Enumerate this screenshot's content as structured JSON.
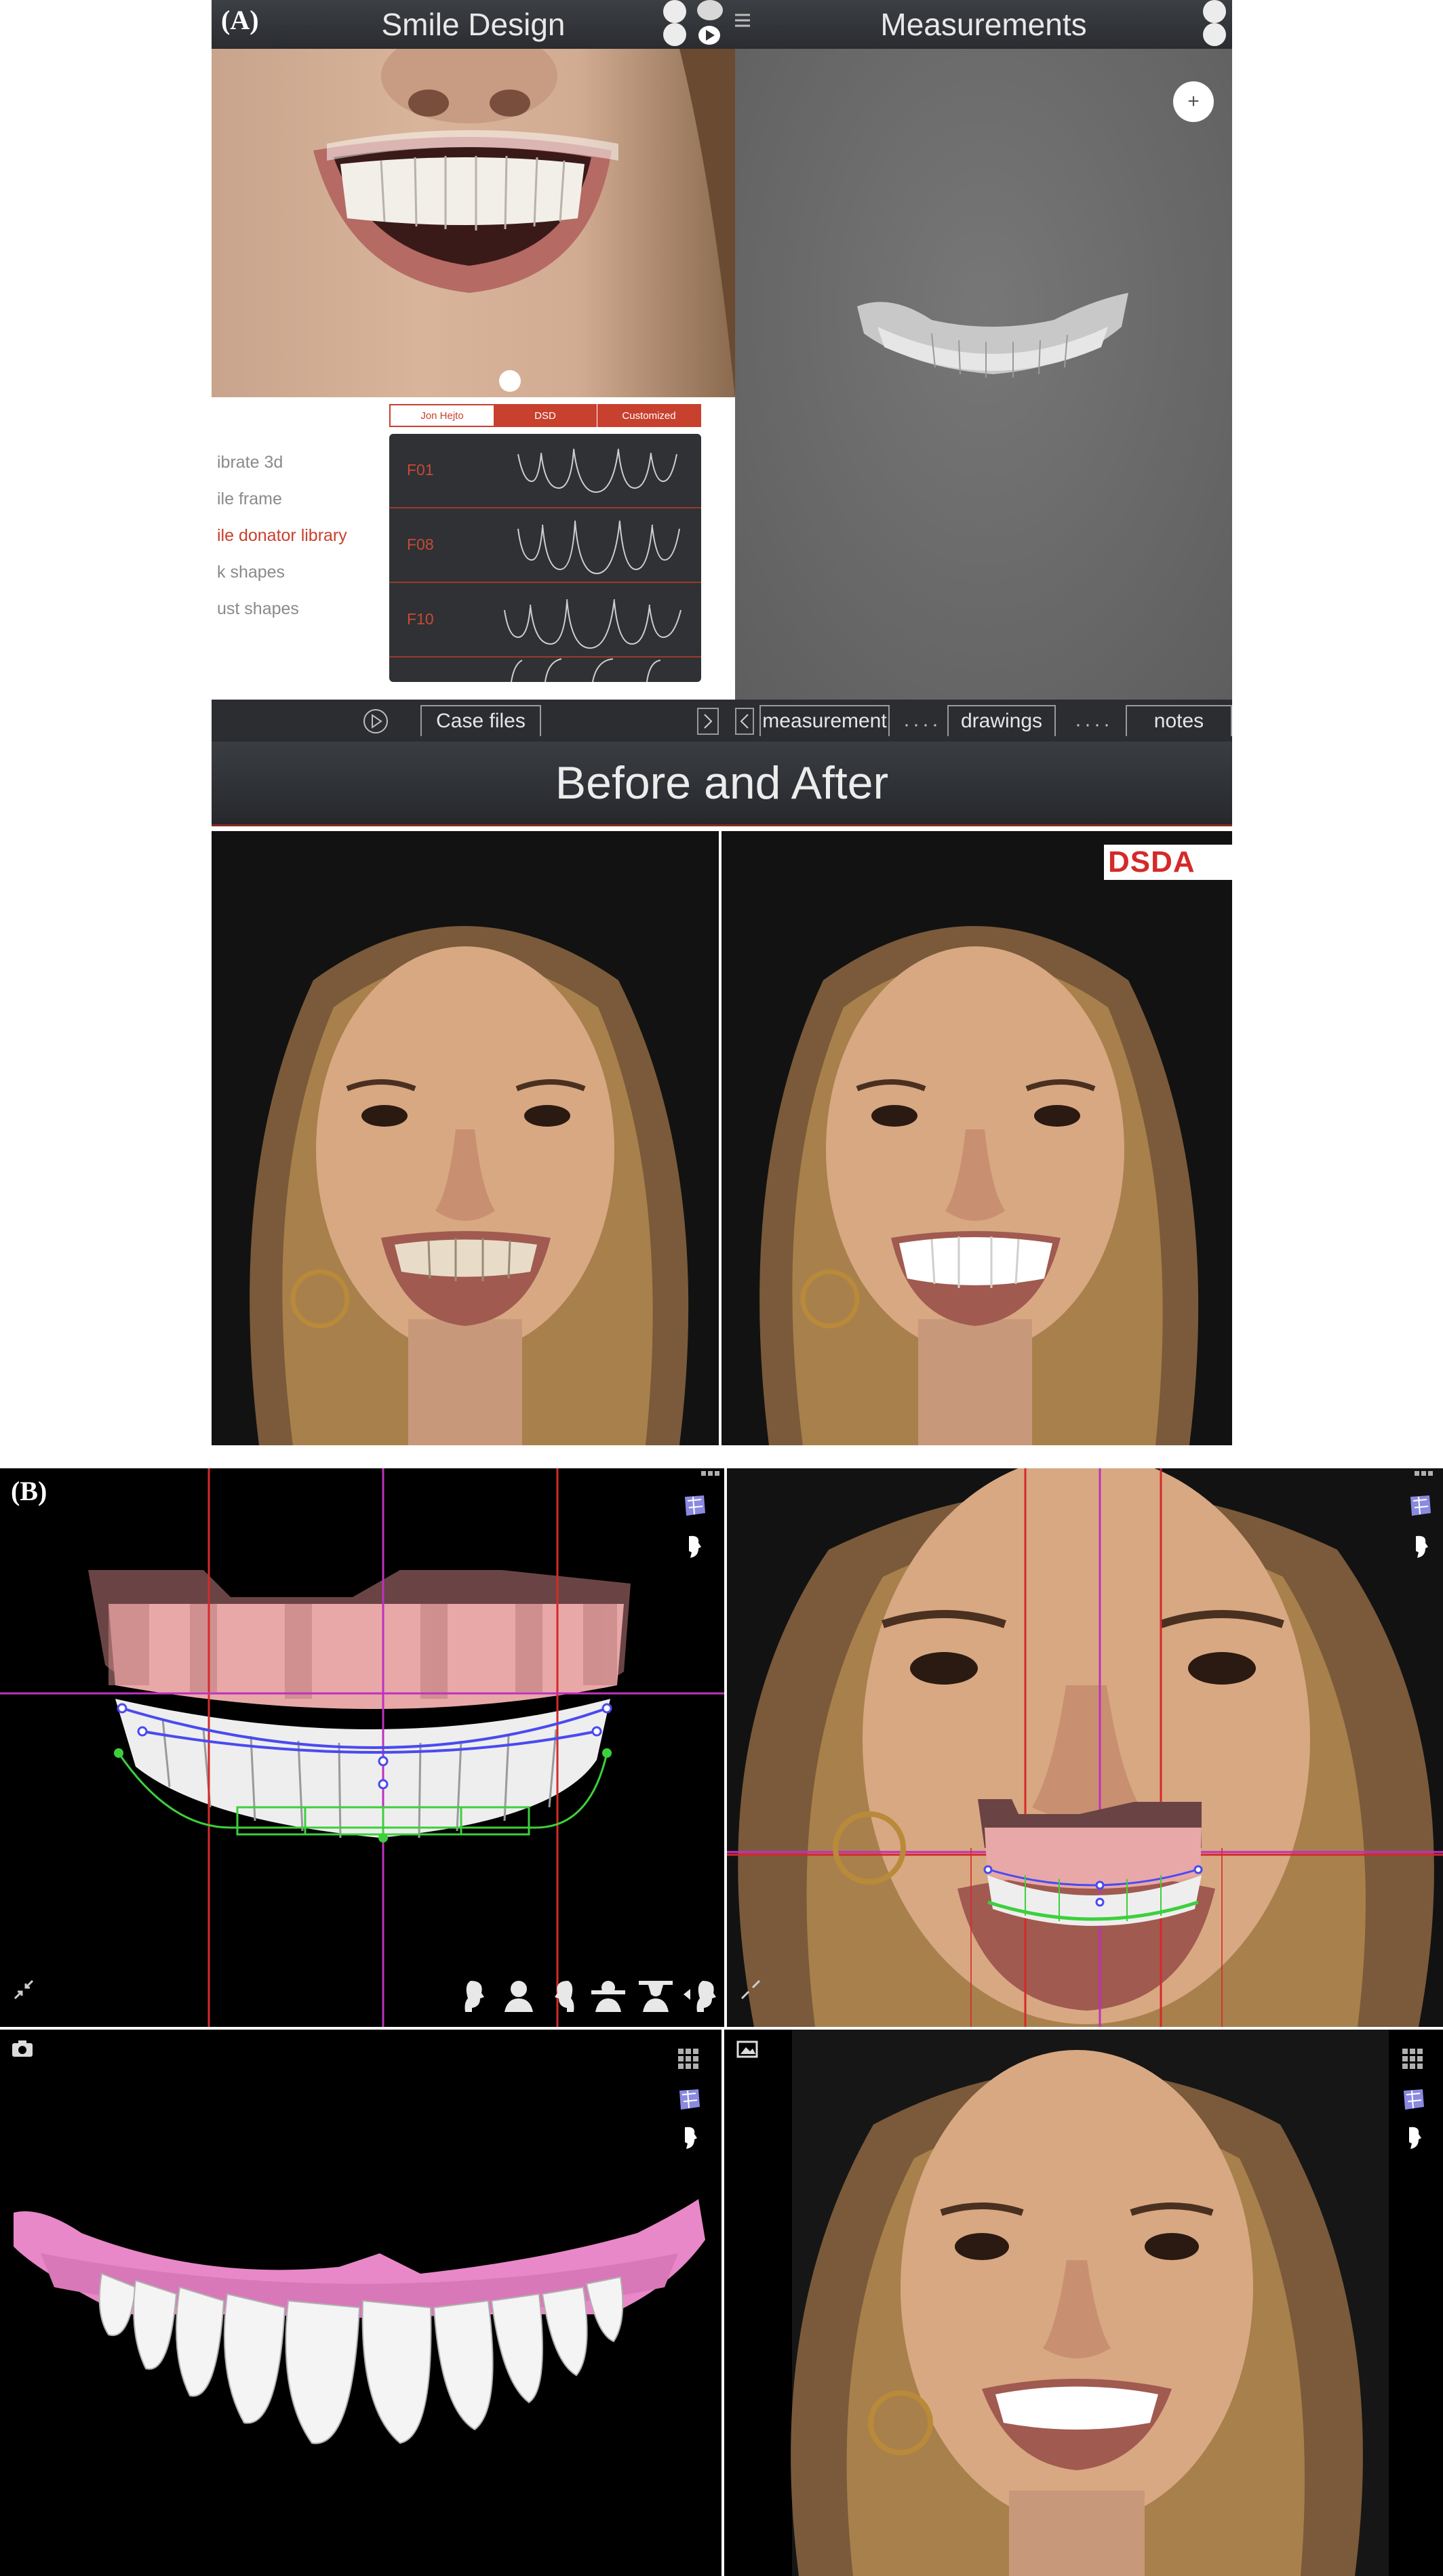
{
  "panel_a": {
    "label": "(A)",
    "smile_design": {
      "title": "Smile Design",
      "menu": [
        {
          "label": "ibrate 3d",
          "active": false
        },
        {
          "label": "ile frame",
          "active": false
        },
        {
          "label": "ile donator library",
          "active": true
        },
        {
          "label": "k shapes",
          "active": false
        },
        {
          "label": "ust shapes",
          "active": false
        }
      ],
      "library_tabs": [
        {
          "label": "Jon Hejto",
          "active": false
        },
        {
          "label": "DSD",
          "active": true
        },
        {
          "label": "Customized",
          "active": false
        }
      ],
      "library_items": [
        "F01",
        "F08",
        "F10"
      ]
    },
    "measurements": {
      "title": "Measurements",
      "add_button": "+"
    },
    "bottom_bar": {
      "case_files": "Case files",
      "tabs": [
        "measurement",
        "drawings",
        "notes"
      ],
      "dots": "····"
    },
    "before_after": {
      "title": "Before and After",
      "logo": "DSDA"
    }
  },
  "panel_b": {
    "label": "(B)"
  },
  "colors": {
    "accent": "#c8402e",
    "toolbar": "#2b2d31",
    "viewport_gray": "#6b6b6b",
    "guide_red": "#d42a2a",
    "guide_magenta": "#c030c0",
    "curve_blue": "#4a4af0",
    "curve_green": "#3cd03c",
    "gingiva_pink": "#e88ac8"
  }
}
